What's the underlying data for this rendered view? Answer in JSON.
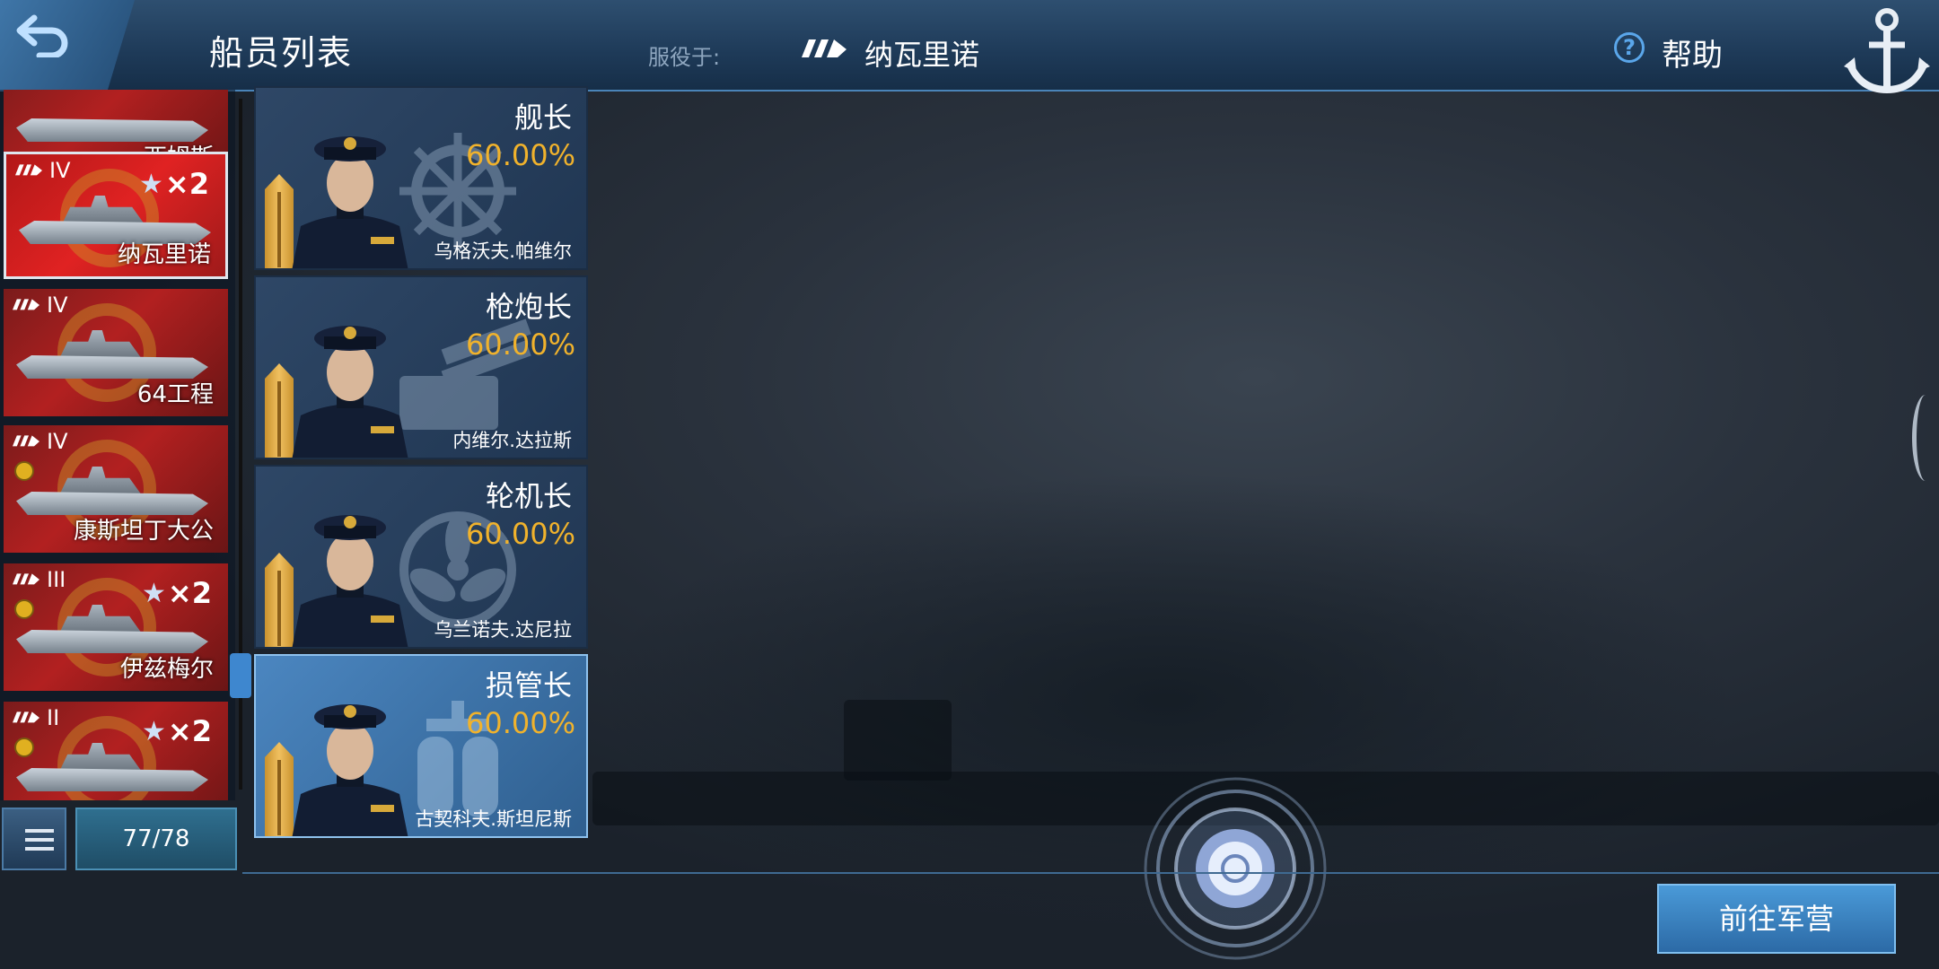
{
  "header": {
    "title": "船员列表",
    "serving_label": "服役于:",
    "serving_ship": "纳瓦里诺",
    "help_label": "帮助"
  },
  "ship_list": {
    "items": [
      {
        "tier": "",
        "name": "西姆斯",
        "bonus": "",
        "selected": false
      },
      {
        "tier": "IV",
        "name": "纳瓦里诺",
        "bonus": "×2",
        "selected": true
      },
      {
        "tier": "IV",
        "name": "64工程",
        "bonus": "",
        "selected": false
      },
      {
        "tier": "IV",
        "name": "康斯坦丁大公",
        "bonus": "",
        "selected": false
      },
      {
        "tier": "III",
        "name": "伊兹梅尔",
        "bonus": "×2",
        "selected": false
      },
      {
        "tier": "II",
        "name": "",
        "bonus": "×2",
        "selected": false
      }
    ],
    "count": "77/78"
  },
  "crew": [
    {
      "role": "舰长",
      "percent": "60.00%",
      "name": "乌格沃夫.帕维尔",
      "icon": "ship-wheel-icon"
    },
    {
      "role": "枪炮长",
      "percent": "60.00%",
      "name": "内维尔.达拉斯",
      "icon": "turret-icon"
    },
    {
      "role": "轮机长",
      "percent": "60.00%",
      "name": "乌兰诺夫.达尼拉",
      "icon": "propeller-icon"
    },
    {
      "role": "损管长",
      "percent": "60.00%",
      "name": "古契科夫.斯坦尼斯",
      "icon": "extinguisher-icon"
    }
  ],
  "footer": {
    "barracks_button": "前往军营"
  },
  "colors": {
    "accent": "#3e87cf",
    "percent": "#f0b22c",
    "ship_card_red": "#b22020"
  }
}
